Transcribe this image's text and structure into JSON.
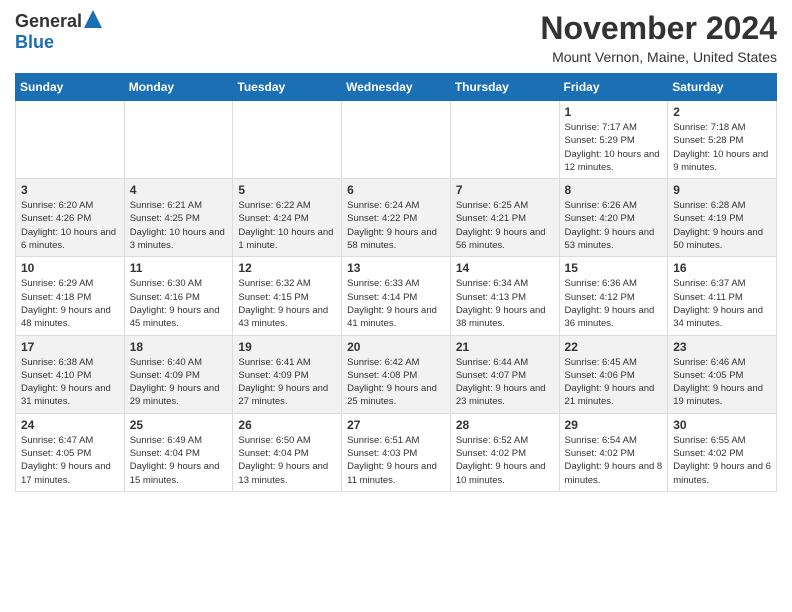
{
  "header": {
    "logo_general": "General",
    "logo_blue": "Blue",
    "month": "November 2024",
    "location": "Mount Vernon, Maine, United States"
  },
  "days_of_week": [
    "Sunday",
    "Monday",
    "Tuesday",
    "Wednesday",
    "Thursday",
    "Friday",
    "Saturday"
  ],
  "weeks": [
    [
      {
        "day": "",
        "info": ""
      },
      {
        "day": "",
        "info": ""
      },
      {
        "day": "",
        "info": ""
      },
      {
        "day": "",
        "info": ""
      },
      {
        "day": "",
        "info": ""
      },
      {
        "day": "1",
        "info": "Sunrise: 7:17 AM\nSunset: 5:29 PM\nDaylight: 10 hours and 12 minutes."
      },
      {
        "day": "2",
        "info": "Sunrise: 7:18 AM\nSunset: 5:28 PM\nDaylight: 10 hours and 9 minutes."
      }
    ],
    [
      {
        "day": "3",
        "info": "Sunrise: 6:20 AM\nSunset: 4:26 PM\nDaylight: 10 hours and 6 minutes."
      },
      {
        "day": "4",
        "info": "Sunrise: 6:21 AM\nSunset: 4:25 PM\nDaylight: 10 hours and 3 minutes."
      },
      {
        "day": "5",
        "info": "Sunrise: 6:22 AM\nSunset: 4:24 PM\nDaylight: 10 hours and 1 minute."
      },
      {
        "day": "6",
        "info": "Sunrise: 6:24 AM\nSunset: 4:22 PM\nDaylight: 9 hours and 58 minutes."
      },
      {
        "day": "7",
        "info": "Sunrise: 6:25 AM\nSunset: 4:21 PM\nDaylight: 9 hours and 56 minutes."
      },
      {
        "day": "8",
        "info": "Sunrise: 6:26 AM\nSunset: 4:20 PM\nDaylight: 9 hours and 53 minutes."
      },
      {
        "day": "9",
        "info": "Sunrise: 6:28 AM\nSunset: 4:19 PM\nDaylight: 9 hours and 50 minutes."
      }
    ],
    [
      {
        "day": "10",
        "info": "Sunrise: 6:29 AM\nSunset: 4:18 PM\nDaylight: 9 hours and 48 minutes."
      },
      {
        "day": "11",
        "info": "Sunrise: 6:30 AM\nSunset: 4:16 PM\nDaylight: 9 hours and 45 minutes."
      },
      {
        "day": "12",
        "info": "Sunrise: 6:32 AM\nSunset: 4:15 PM\nDaylight: 9 hours and 43 minutes."
      },
      {
        "day": "13",
        "info": "Sunrise: 6:33 AM\nSunset: 4:14 PM\nDaylight: 9 hours and 41 minutes."
      },
      {
        "day": "14",
        "info": "Sunrise: 6:34 AM\nSunset: 4:13 PM\nDaylight: 9 hours and 38 minutes."
      },
      {
        "day": "15",
        "info": "Sunrise: 6:36 AM\nSunset: 4:12 PM\nDaylight: 9 hours and 36 minutes."
      },
      {
        "day": "16",
        "info": "Sunrise: 6:37 AM\nSunset: 4:11 PM\nDaylight: 9 hours and 34 minutes."
      }
    ],
    [
      {
        "day": "17",
        "info": "Sunrise: 6:38 AM\nSunset: 4:10 PM\nDaylight: 9 hours and 31 minutes."
      },
      {
        "day": "18",
        "info": "Sunrise: 6:40 AM\nSunset: 4:09 PM\nDaylight: 9 hours and 29 minutes."
      },
      {
        "day": "19",
        "info": "Sunrise: 6:41 AM\nSunset: 4:09 PM\nDaylight: 9 hours and 27 minutes."
      },
      {
        "day": "20",
        "info": "Sunrise: 6:42 AM\nSunset: 4:08 PM\nDaylight: 9 hours and 25 minutes."
      },
      {
        "day": "21",
        "info": "Sunrise: 6:44 AM\nSunset: 4:07 PM\nDaylight: 9 hours and 23 minutes."
      },
      {
        "day": "22",
        "info": "Sunrise: 6:45 AM\nSunset: 4:06 PM\nDaylight: 9 hours and 21 minutes."
      },
      {
        "day": "23",
        "info": "Sunrise: 6:46 AM\nSunset: 4:05 PM\nDaylight: 9 hours and 19 minutes."
      }
    ],
    [
      {
        "day": "24",
        "info": "Sunrise: 6:47 AM\nSunset: 4:05 PM\nDaylight: 9 hours and 17 minutes."
      },
      {
        "day": "25",
        "info": "Sunrise: 6:49 AM\nSunset: 4:04 PM\nDaylight: 9 hours and 15 minutes."
      },
      {
        "day": "26",
        "info": "Sunrise: 6:50 AM\nSunset: 4:04 PM\nDaylight: 9 hours and 13 minutes."
      },
      {
        "day": "27",
        "info": "Sunrise: 6:51 AM\nSunset: 4:03 PM\nDaylight: 9 hours and 11 minutes."
      },
      {
        "day": "28",
        "info": "Sunrise: 6:52 AM\nSunset: 4:02 PM\nDaylight: 9 hours and 10 minutes."
      },
      {
        "day": "29",
        "info": "Sunrise: 6:54 AM\nSunset: 4:02 PM\nDaylight: 9 hours and 8 minutes."
      },
      {
        "day": "30",
        "info": "Sunrise: 6:55 AM\nSunset: 4:02 PM\nDaylight: 9 hours and 6 minutes."
      }
    ]
  ]
}
